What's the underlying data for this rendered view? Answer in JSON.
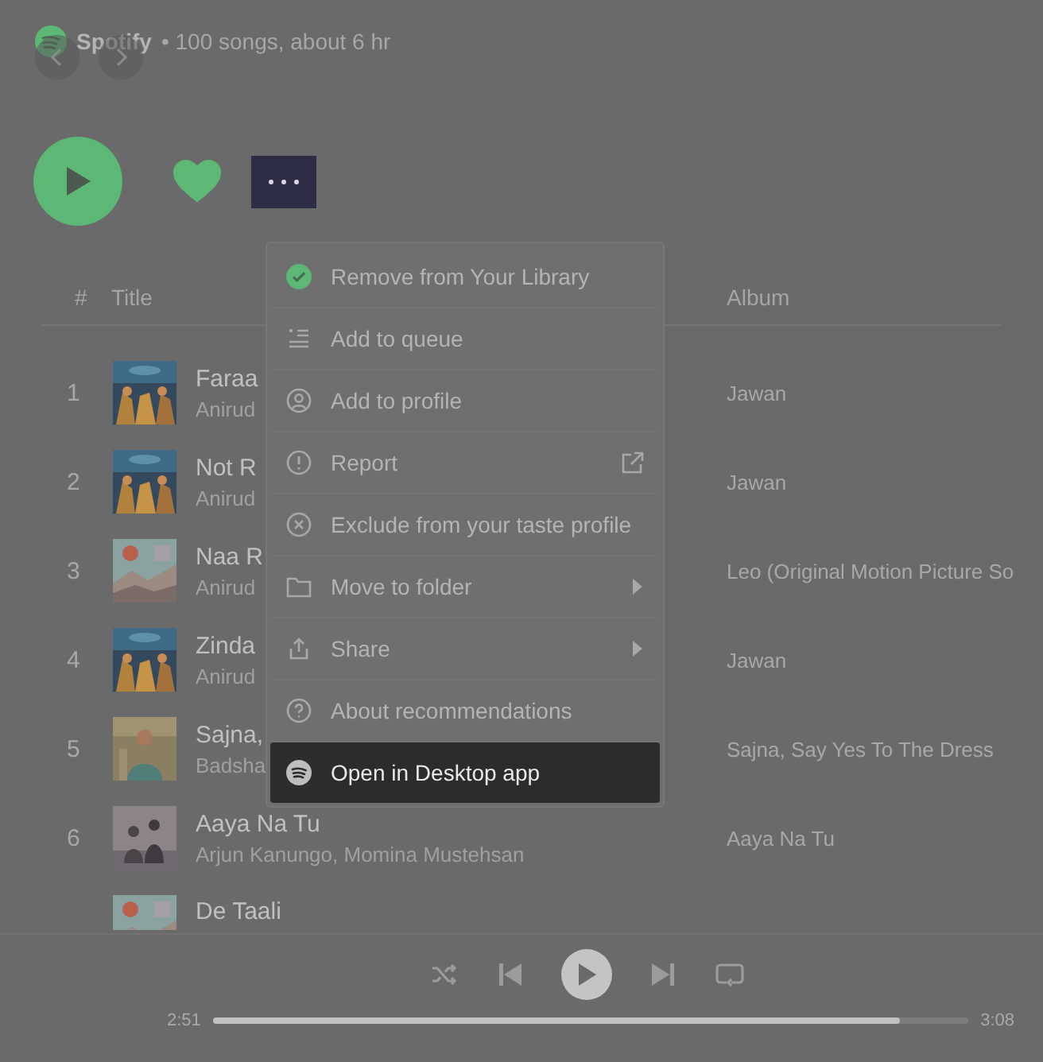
{
  "playlist": {
    "owner": "Spotify",
    "meta": "• 100 songs, about 6 hr"
  },
  "actions": {
    "liked": true
  },
  "table": {
    "columns": [
      "#",
      "Title",
      "Album"
    ],
    "rows": [
      {
        "number": "1",
        "title": "Faraa",
        "artist": "Anirud",
        "album": "Jawan"
      },
      {
        "number": "2",
        "title": "Not R",
        "artist": "Anirud",
        "album": "Jawan"
      },
      {
        "number": "3",
        "title": "Naa R",
        "artist": "Anirud",
        "album": "Leo (Original Motion Picture So"
      },
      {
        "number": "4",
        "title": "Zinda",
        "artist": "Anirud",
        "album": "Jawan"
      },
      {
        "number": "5",
        "title": "Sajna,",
        "artist": "Badsha",
        "album": "Sajna, Say Yes To The Dress"
      },
      {
        "number": "6",
        "title": "Aaya Na Tu",
        "artist": "Arjun Kanungo, Momina Mustehsan",
        "album": "Aaya Na Tu"
      },
      {
        "title": "De Taali"
      }
    ]
  },
  "menu": {
    "items": [
      {
        "label": "Remove from Your Library",
        "kind": "plain",
        "selected": false
      },
      {
        "label": "Add to queue",
        "kind": "plain",
        "selected": false
      },
      {
        "label": "Add to profile",
        "kind": "plain",
        "selected": false
      },
      {
        "label": "Report",
        "kind": "external",
        "selected": false
      },
      {
        "label": "Exclude from your taste profile",
        "kind": "plain",
        "selected": false
      },
      {
        "label": "Move to folder",
        "kind": "submenu",
        "selected": false
      },
      {
        "label": "Share",
        "kind": "submenu",
        "selected": false
      },
      {
        "label": "About recommendations",
        "kind": "plain",
        "selected": false
      },
      {
        "label": "Open in Desktop app",
        "kind": "plain",
        "selected": true
      }
    ]
  },
  "player": {
    "elapsed": "2:51",
    "duration": "3:08",
    "level": 0.91
  }
}
